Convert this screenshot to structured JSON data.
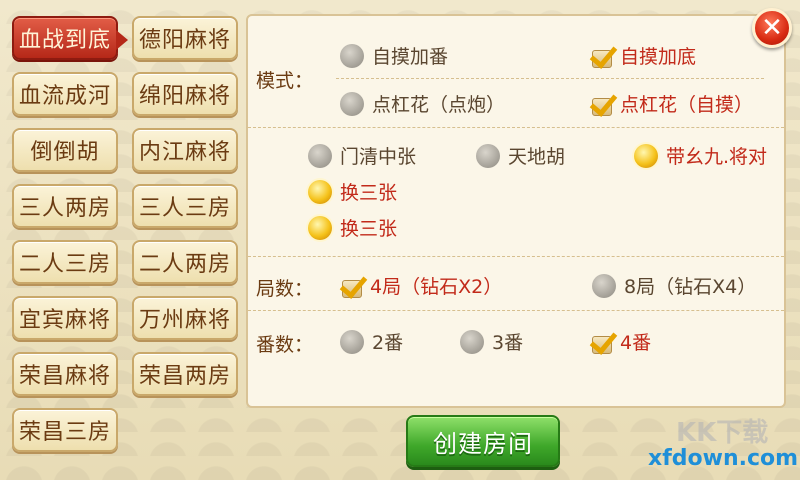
{
  "modes": [
    {
      "label": "血战到底",
      "active": true
    },
    {
      "label": "德阳麻将"
    },
    {
      "label": "血流成河"
    },
    {
      "label": "绵阳麻将"
    },
    {
      "label": "倒倒胡"
    },
    {
      "label": "内江麻将"
    },
    {
      "label": "三人两房"
    },
    {
      "label": "三人三房"
    },
    {
      "label": "二人三房"
    },
    {
      "label": "二人两房"
    },
    {
      "label": "宜宾麻将"
    },
    {
      "label": "万州麻将"
    },
    {
      "label": "荣昌麻将"
    },
    {
      "label": "荣昌两房"
    },
    {
      "label": "荣昌三房"
    }
  ],
  "close_label": "✕",
  "mode_section": {
    "label": "模式：",
    "options": [
      "自摸加番",
      "自摸加底",
      "点杠花（点炮）",
      "点杠花（自摸）"
    ]
  },
  "rules_section": {
    "options": [
      "门清中张",
      "天地胡",
      "带幺九.将对",
      "换三张",
      "换三张"
    ]
  },
  "rounds_section": {
    "label": "局数：",
    "options": [
      "4局（钻石X2）",
      "8局（钻石X4）"
    ]
  },
  "fan_section": {
    "label": "番数：",
    "options": [
      "2番",
      "3番",
      "4番"
    ]
  },
  "create_button": "创建房间",
  "watermark": "xfdown.com",
  "watermark_cn": "KK下载"
}
